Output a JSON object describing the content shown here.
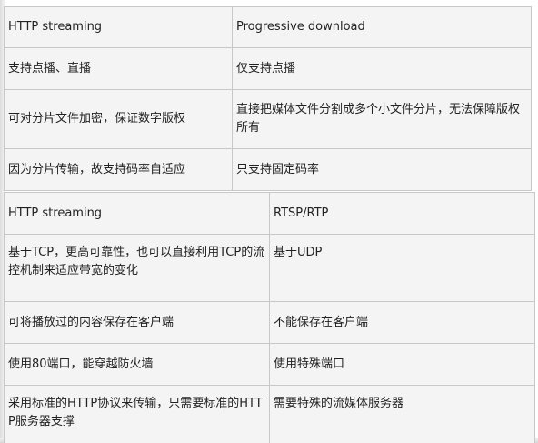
{
  "table1": {
    "headers": [
      "HTTP streaming",
      "Progressive download"
    ],
    "rows": [
      [
        "支持点播、直播",
        "仅支持点播"
      ],
      [
        "可对分片文件加密，保证数字版权",
        "直接把媒体文件分割成多个小文件分片，无法保障版权所有"
      ],
      [
        "因为分片传输，故支持码率自适应",
        "只支持固定码率"
      ]
    ]
  },
  "table2": {
    "headers": [
      "HTTP streaming",
      "RTSP/RTP"
    ],
    "rows": [
      [
        "基于TCP，更高可靠性，也可以直接利用TCP的流控机制来适应带宽的变化",
        "基于UDP"
      ],
      [
        "可将播放过的内容保存在客户端",
        "不能保存在客户端"
      ],
      [
        "使用80端口，能穿越防火墙",
        "使用特殊端口"
      ],
      [
        "采用标准的HTTP协议来传输，只需要标准的HTTP服务器支撑",
        "需要特殊的流媒体服务器"
      ]
    ]
  }
}
